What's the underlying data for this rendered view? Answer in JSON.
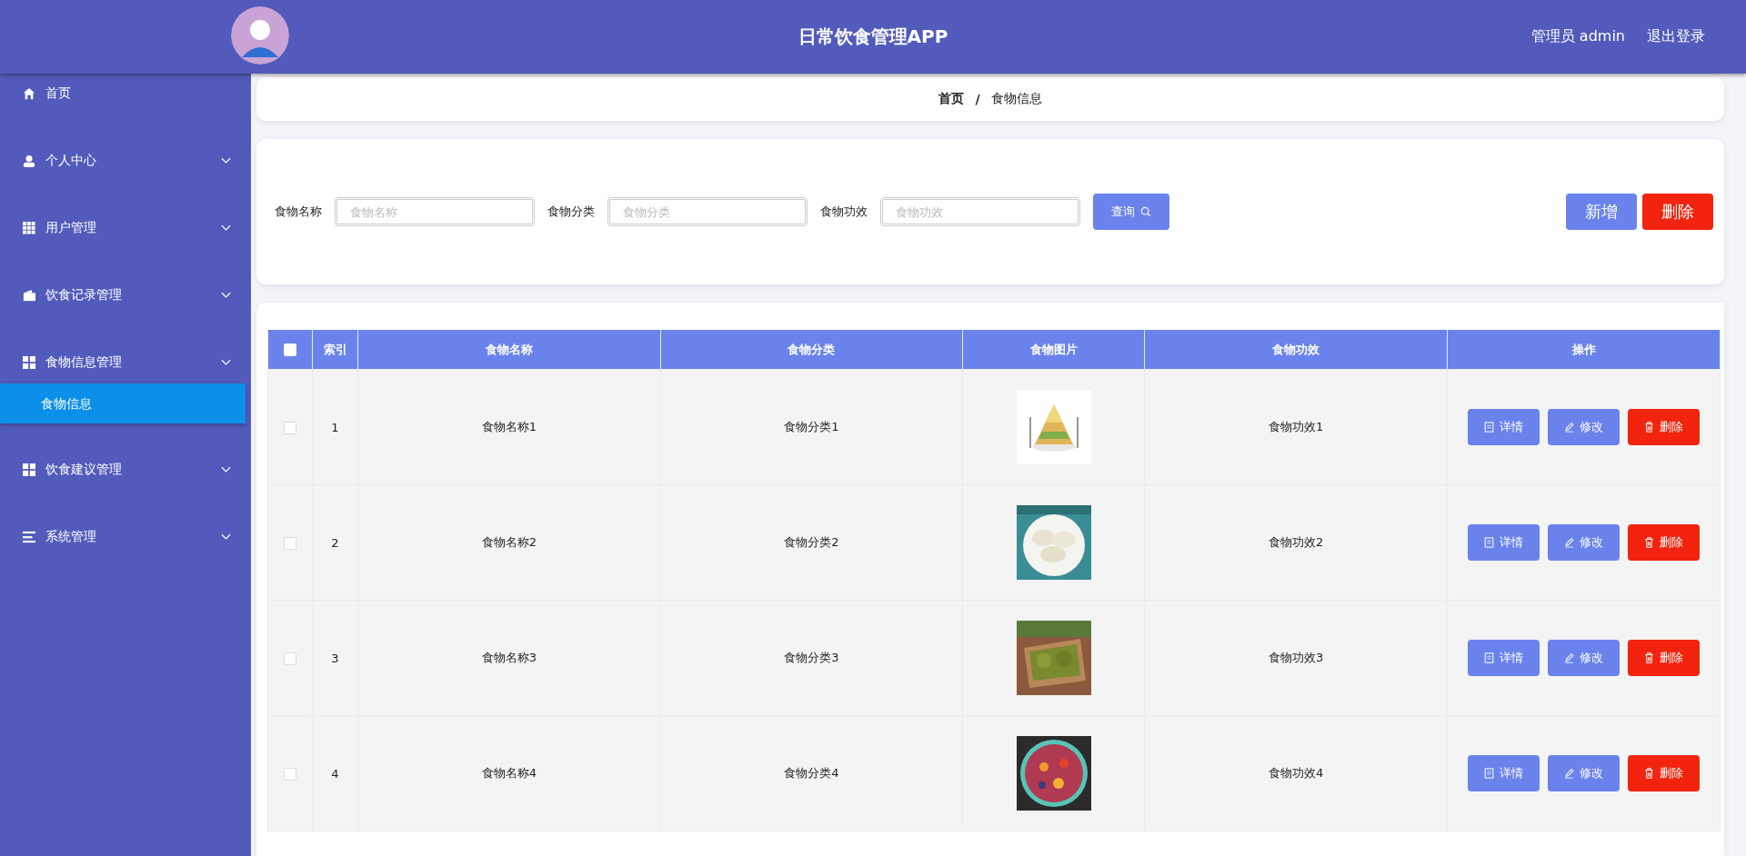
{
  "header": {
    "title": "日常饮食管理APP",
    "user": "管理员 admin",
    "logout": "退出登录"
  },
  "sidebar": {
    "items": [
      {
        "label": "首页",
        "kind": "link"
      },
      {
        "label": "个人中心",
        "kind": "menu"
      },
      {
        "label": "用户管理",
        "kind": "menu"
      },
      {
        "label": "饮食记录管理",
        "kind": "menu"
      },
      {
        "label": "食物信息管理",
        "kind": "menu",
        "expanded": true,
        "children": [
          {
            "label": "食物信息",
            "selected": true
          }
        ]
      },
      {
        "label": "饮食建议管理",
        "kind": "menu"
      },
      {
        "label": "系统管理",
        "kind": "menu"
      }
    ]
  },
  "breadcrumb": {
    "items": [
      "首页",
      "食物信息"
    ],
    "separator": "/"
  },
  "search": {
    "fields": [
      {
        "label": "食物名称",
        "placeholder": "食物名称"
      },
      {
        "label": "食物分类",
        "placeholder": "食物分类"
      },
      {
        "label": "食物功效",
        "placeholder": "食物功效"
      }
    ],
    "query_button": "查询",
    "add_button": "新增",
    "delete_button": "删除"
  },
  "table": {
    "header_checked": false,
    "columns": [
      "索引",
      "食物名称",
      "食物分类",
      "食物图片",
      "食物功效",
      "操作"
    ],
    "rows": [
      {
        "checked": false,
        "index": "1",
        "name": "食物名称1",
        "category": "食物分类1",
        "effect": "食物功效1",
        "actions": [
          "详情",
          "修改",
          "删除"
        ]
      },
      {
        "checked": false,
        "index": "2",
        "name": "食物名称2",
        "category": "食物分类2",
        "effect": "食物功效2",
        "actions": [
          "详情",
          "修改",
          "删除"
        ]
      },
      {
        "checked": false,
        "index": "3",
        "name": "食物名称3",
        "category": "食物分类3",
        "effect": "食物功效3",
        "actions": [
          "详情",
          "修改",
          "删除"
        ]
      },
      {
        "checked": false,
        "index": "4",
        "name": "食物名称4",
        "category": "食物分类4",
        "effect": "食物功效4",
        "actions": [
          "详情",
          "修改",
          "删除"
        ]
      }
    ]
  }
}
